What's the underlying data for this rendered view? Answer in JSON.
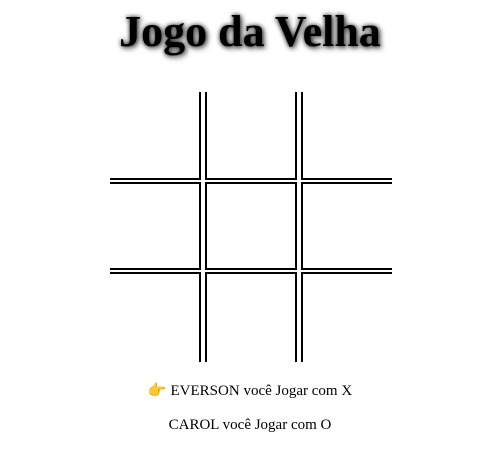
{
  "title": "Jogo da Velha",
  "board": {
    "cells": [
      "",
      "",
      "",
      "",
      "",
      "",
      "",
      "",
      ""
    ]
  },
  "players": [
    {
      "turn_icon": "👉",
      "turn_icon_name": "pointing-hand-icon",
      "name": "EVERSON",
      "text": "você Jogar com X",
      "active": true
    },
    {
      "turn_icon": "",
      "turn_icon_name": "pointing-hand-icon",
      "name": "CAROL",
      "text": "você Jogar com O",
      "active": false
    }
  ],
  "colors": {
    "background": "#ffffff",
    "lines": "#000000",
    "text": "#000000"
  }
}
